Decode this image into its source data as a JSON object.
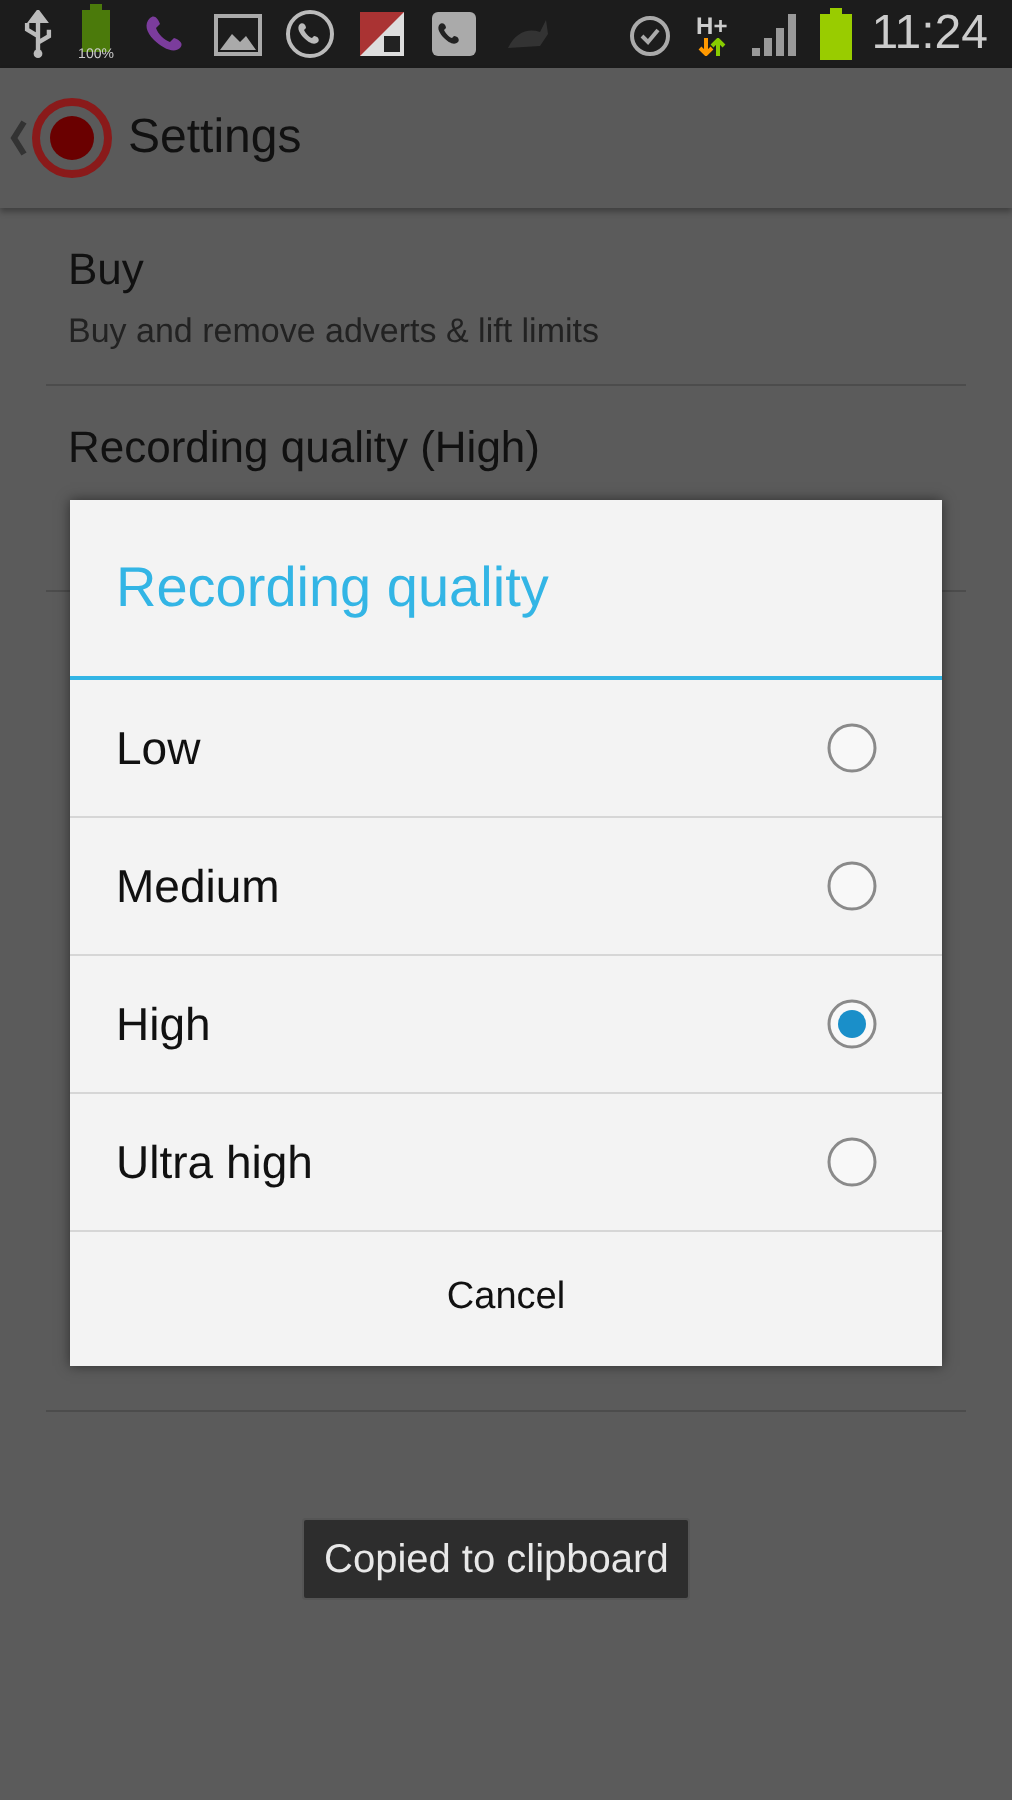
{
  "status_bar": {
    "battery_percent": "100%",
    "network": "H+",
    "time": "11:24"
  },
  "action_bar": {
    "title": "Settings"
  },
  "settings": [
    {
      "title": "Buy",
      "summary": "Buy and remove adverts & lift limits"
    },
    {
      "title": "Recording quality (High)"
    }
  ],
  "dialog": {
    "title": "Recording quality",
    "options": [
      {
        "label": "Low",
        "selected": false
      },
      {
        "label": "Medium",
        "selected": false
      },
      {
        "label": "High",
        "selected": true
      },
      {
        "label": "Ultra high",
        "selected": false
      }
    ],
    "cancel": "Cancel"
  },
  "toast": "Copied to clipboard"
}
